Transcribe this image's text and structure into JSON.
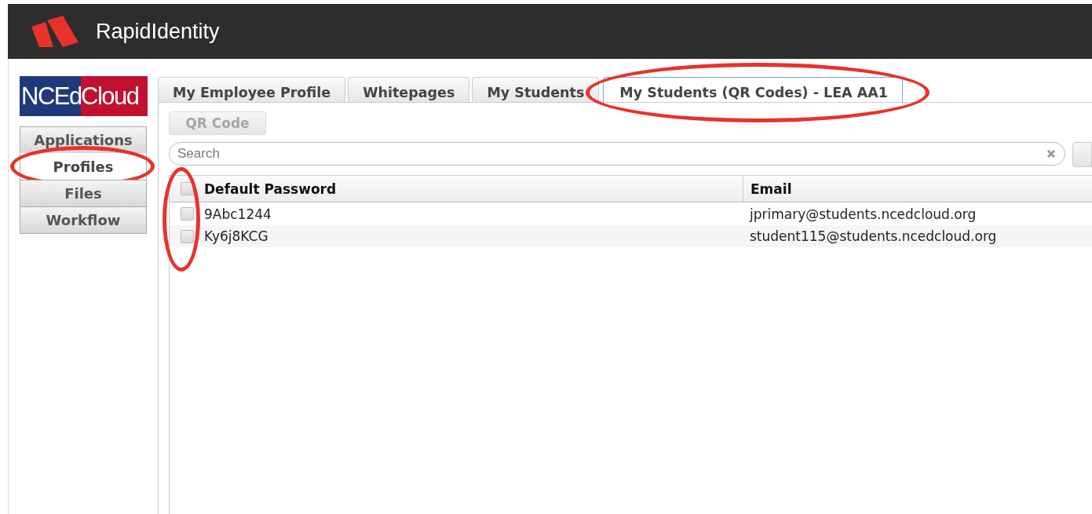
{
  "app": {
    "title": "RapidIdentity"
  },
  "logo": {
    "left": "NCEd",
    "right": "Cloud"
  },
  "nav": [
    {
      "label": "Applications",
      "selected": false,
      "circled": false
    },
    {
      "label": "Profiles",
      "selected": true,
      "circled": true
    },
    {
      "label": "Files",
      "selected": false,
      "circled": false
    },
    {
      "label": "Workflow",
      "selected": false,
      "circled": false
    }
  ],
  "tabs": [
    {
      "label": "My Employee Profile",
      "selected": false,
      "circled": false
    },
    {
      "label": "Whitepages",
      "selected": false,
      "circled": false
    },
    {
      "label": "My Students",
      "selected": false,
      "circled": false
    },
    {
      "label": "My Students (QR Codes) - LEA AA1",
      "selected": true,
      "circled": true
    }
  ],
  "qr_button": {
    "label": "QR Code",
    "disabled": true
  },
  "search": {
    "placeholder": "Search"
  },
  "table": {
    "select_all_checked": false,
    "checkboxes_circled": true,
    "columns": [
      "Default Password",
      "Email"
    ],
    "rows": [
      {
        "checked": false,
        "cells": [
          "9Abc1244",
          "jprimary@students.ncedcloud.org"
        ]
      },
      {
        "checked": false,
        "cells": [
          "Ky6j8KCG",
          "student115@students.ncedcloud.org"
        ]
      }
    ]
  }
}
